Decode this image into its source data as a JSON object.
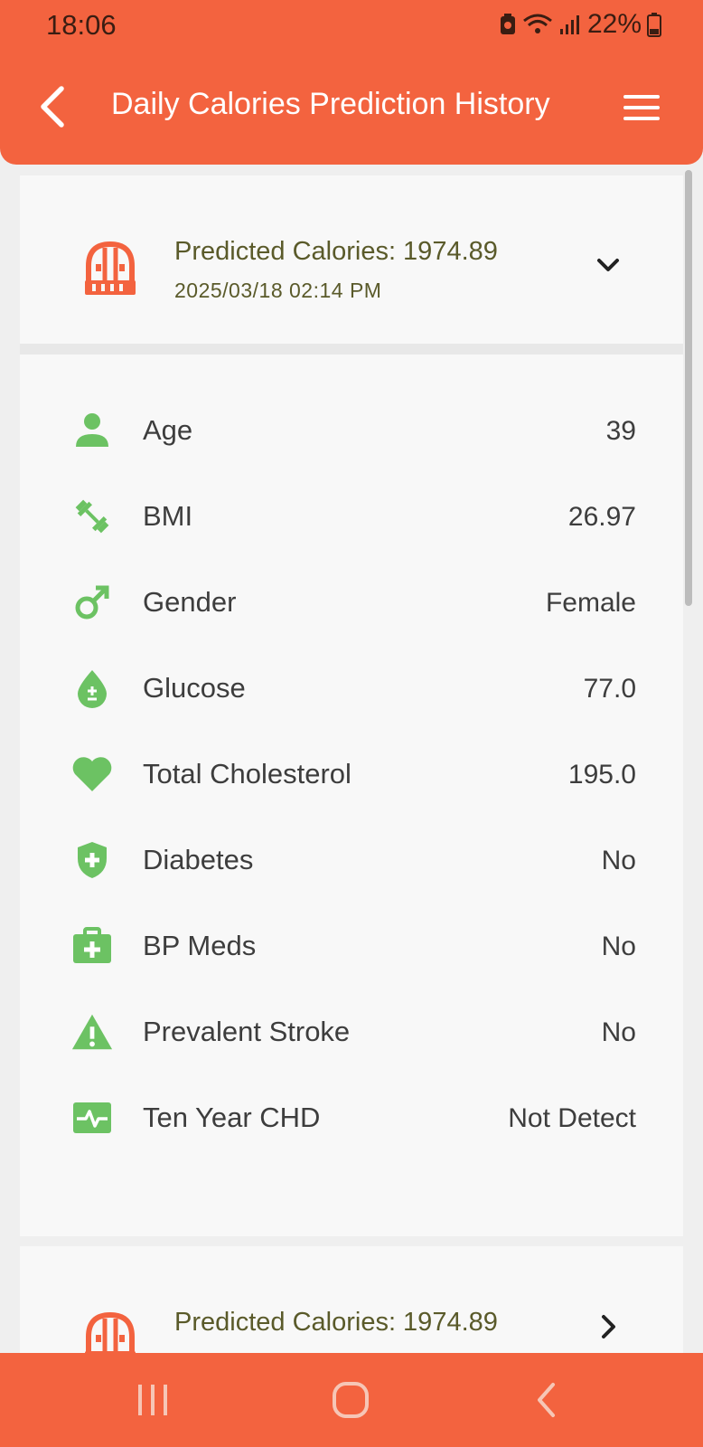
{
  "status": {
    "time": "18:06",
    "battery": "22%"
  },
  "header": {
    "title": "Daily Calories Prediction History"
  },
  "colors": {
    "brand": "#f3633f",
    "icon_green": "#6cc263",
    "card_bg": "#f8f8f8"
  },
  "records": [
    {
      "title": "Predicted Calories: 1974.89",
      "date": "2025/03/18 02:14 PM",
      "expanded": true,
      "chevron": "chevron-down-icon",
      "details": [
        {
          "icon": "person-icon",
          "label": "Age",
          "value": "39"
        },
        {
          "icon": "dumbbell-icon",
          "label": "BMI",
          "value": "26.97"
        },
        {
          "icon": "male-symbol-icon",
          "label": "Gender",
          "value": "Female"
        },
        {
          "icon": "glucose-drop-icon",
          "label": "Glucose",
          "value": "77.0"
        },
        {
          "icon": "heart-icon",
          "label": "Total Cholesterol",
          "value": "195.0"
        },
        {
          "icon": "shield-plus-icon",
          "label": "Diabetes",
          "value": "No"
        },
        {
          "icon": "medkit-icon",
          "label": "BP Meds",
          "value": "No"
        },
        {
          "icon": "warning-icon",
          "label": "Prevalent Stroke",
          "value": "No"
        },
        {
          "icon": "heartbeat-icon",
          "label": "Ten Year CHD",
          "value": "Not Detect"
        }
      ]
    },
    {
      "title": "Predicted Calories: 1974.89",
      "date": "",
      "expanded": false,
      "chevron": "chevron-right-icon"
    }
  ],
  "navbar": {
    "buttons": [
      "recent-apps-button",
      "home-button",
      "back-nav-button"
    ]
  }
}
